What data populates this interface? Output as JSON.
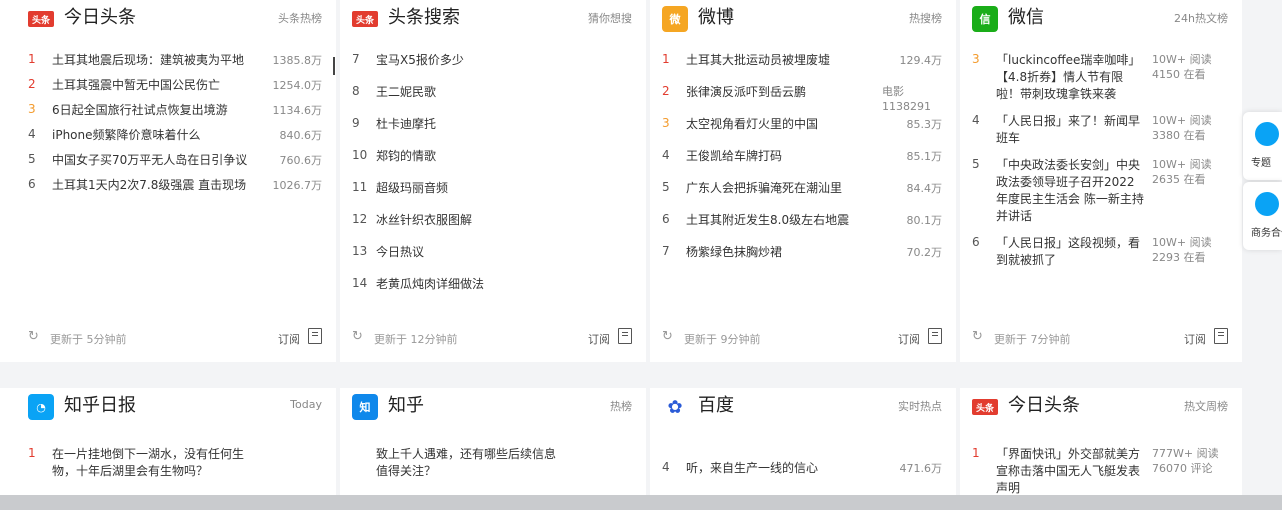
{
  "cards": [
    {
      "key": "tt",
      "title": "今日头条",
      "subtitle": "头条热榜",
      "logo_text": "头条",
      "logo_color": "#e23c2f",
      "items": [
        {
          "num": "1",
          "text": "土耳其地震后现场：建筑被夷为平地",
          "value": "1385.8万"
        },
        {
          "num": "2",
          "text": "土耳其强震中暂无中国公民伤亡",
          "value": "1254.0万"
        },
        {
          "num": "3",
          "text": "6日起全国旅行社试点恢复出境游",
          "value": "1134.6万"
        },
        {
          "num": "4",
          "text": "iPhone频繁降价意味着什么",
          "value": "840.6万"
        },
        {
          "num": "5",
          "text": "中国女子买70万平无人岛在日引争议",
          "value": "760.6万"
        },
        {
          "num": "6",
          "text": "土耳其1天内2次7.8级强震 直击现场",
          "value": "1026.7万"
        }
      ],
      "update": "更新于 5分钟前",
      "subscribe": "订阅"
    },
    {
      "key": "search",
      "title": "头条搜索",
      "subtitle": "猜你想搜",
      "logo_text": "头条",
      "logo_color": "#e23c2f",
      "items": [
        {
          "num": "7",
          "text": "宝马X5报价多少",
          "value": ""
        },
        {
          "num": "8",
          "text": "王二妮民歌",
          "value": ""
        },
        {
          "num": "9",
          "text": "杜卡迪摩托",
          "value": ""
        },
        {
          "num": "10",
          "text": "郑钧的情歌",
          "value": ""
        },
        {
          "num": "11",
          "text": "超级玛丽音频",
          "value": ""
        },
        {
          "num": "12",
          "text": "冰丝针织衣服图解",
          "value": ""
        },
        {
          "num": "13",
          "text": "今日热议",
          "value": ""
        },
        {
          "num": "14",
          "text": "老黄瓜炖肉详细做法",
          "value": ""
        }
      ],
      "update": "更新于 12分钟前",
      "subscribe": "订阅"
    },
    {
      "key": "weibo",
      "title": "微博",
      "subtitle": "热搜榜",
      "logo_text": "微",
      "logo_color": "#f5a623",
      "items": [
        {
          "num": "1",
          "text": "土耳其大批运动员被埋废墟",
          "value": "129.4万"
        },
        {
          "num": "2",
          "text": "张律演反派吓到岳云鹏",
          "value": "电影 1138291"
        },
        {
          "num": "3",
          "text": "太空视角看灯火里的中国",
          "value": "85.3万"
        },
        {
          "num": "4",
          "text": "王俊凯给车牌打码",
          "value": "85.1万"
        },
        {
          "num": "5",
          "text": "广东人会把拆骗淹死在潮汕里",
          "value": "84.4万"
        },
        {
          "num": "6",
          "text": "土耳其附近发生8.0级左右地震",
          "value": "80.1万"
        },
        {
          "num": "7",
          "text": "杨紫绿色抹胸炒裙",
          "value": "70.2万"
        }
      ],
      "update": "更新于 9分钟前",
      "subscribe": "订阅"
    },
    {
      "key": "wechat",
      "title": "微信",
      "subtitle": "24h热文榜",
      "logo_text": "信",
      "logo_color": "#1aad19",
      "items": [
        {
          "num": "3",
          "text": "「luckincoffee瑞幸咖啡」【4.8折券】情人节有限啦！带刺玫瑰拿铁来袭",
          "value": "10W+ 阅读 4150 在看"
        },
        {
          "num": "4",
          "text": "「人民日报」来了！新闻早班车",
          "value": "10W+ 阅读 3380 在看"
        },
        {
          "num": "5",
          "text": "「中央政法委长安剑」中央政法委领导班子召开2022年度民主生活会 陈一新主持并讲话",
          "value": "10W+ 阅读 2635 在看"
        },
        {
          "num": "6",
          "text": "「人民日报」这段视频，看到就被抓了",
          "value": "10W+ 阅读 2293 在看"
        }
      ],
      "update": "更新于 7分钟前",
      "subscribe": "订阅"
    },
    {
      "key": "zhihudaily",
      "title": "知乎日报",
      "subtitle": "Today",
      "logo_text": "◔",
      "logo_color": "#0aa3f5",
      "items": [
        {
          "num": "1",
          "text": "在一片挂地倒下一湖水，没有任何生物，十年后湖里会有生物吗？",
          "value": ""
        }
      ]
    },
    {
      "key": "zhihu",
      "title": "知乎",
      "subtitle": "热榜",
      "logo_text": "知",
      "logo_color": "#0f88eb",
      "items": [
        {
          "num": "",
          "text": "致上千人遇难，还有哪些后续信息值得关注？",
          "value": ""
        }
      ]
    },
    {
      "key": "baidu",
      "title": "百度",
      "subtitle": "实时热点",
      "logo_text": "✿",
      "logo_color": "#2b5bd7",
      "items": [
        {
          "num": "4",
          "text": "听，来自生产一线的信心",
          "value": "471.6万"
        }
      ]
    },
    {
      "key": "tt2",
      "title": "今日头条",
      "subtitle": "热文周榜",
      "logo_text": "头条",
      "logo_color": "#e23c2f",
      "items": [
        {
          "num": "1",
          "text": "「界面快讯」外交部就美方宣称击落中国无人飞艇发表声明",
          "value": "777W+ 阅读 76070 评论"
        }
      ]
    }
  ],
  "side": [
    {
      "label": "专题"
    },
    {
      "label": "商务合作"
    }
  ]
}
